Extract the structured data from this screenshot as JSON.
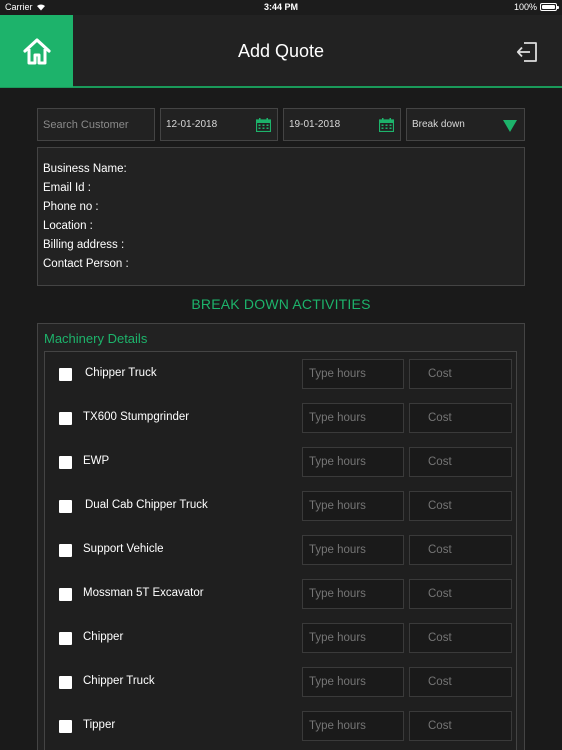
{
  "status_bar": {
    "carrier": "Carrier",
    "time": "3:44 PM",
    "battery": "100%"
  },
  "nav": {
    "title": "Add Quote",
    "home_icon": "home-icon",
    "logout_icon": "logout-icon"
  },
  "filters": {
    "search_placeholder": "Search Customer",
    "start_date": "12-01-2018",
    "end_date": "19-01-2018",
    "type_selected": "Break down"
  },
  "customer_info": {
    "business_name": "Business Name:",
    "email": "Email Id :",
    "phone": "Phone no :",
    "location": "Location :",
    "billing_address": "Billing address :",
    "contact_person": "Contact Person :"
  },
  "section_title": "BREAK DOWN ACTIVITIES",
  "machinery": {
    "header": "Machinery Details",
    "hours_placeholder": "Type hours",
    "cost_placeholder": "Cost",
    "items": [
      {
        "name": "Chipper Truck"
      },
      {
        "name": "TX600 Stumpgrinder"
      },
      {
        "name": "EWP"
      },
      {
        "name": "Dual Cab Chipper Truck"
      },
      {
        "name": "Support Vehicle"
      },
      {
        "name": "Mossman 5T Excavator"
      },
      {
        "name": "Chipper"
      },
      {
        "name": "Chipper Truck"
      },
      {
        "name": "Tipper"
      }
    ]
  },
  "colors": {
    "accent": "#1db36b",
    "background": "#1a1a1a",
    "panel": "#222222"
  }
}
